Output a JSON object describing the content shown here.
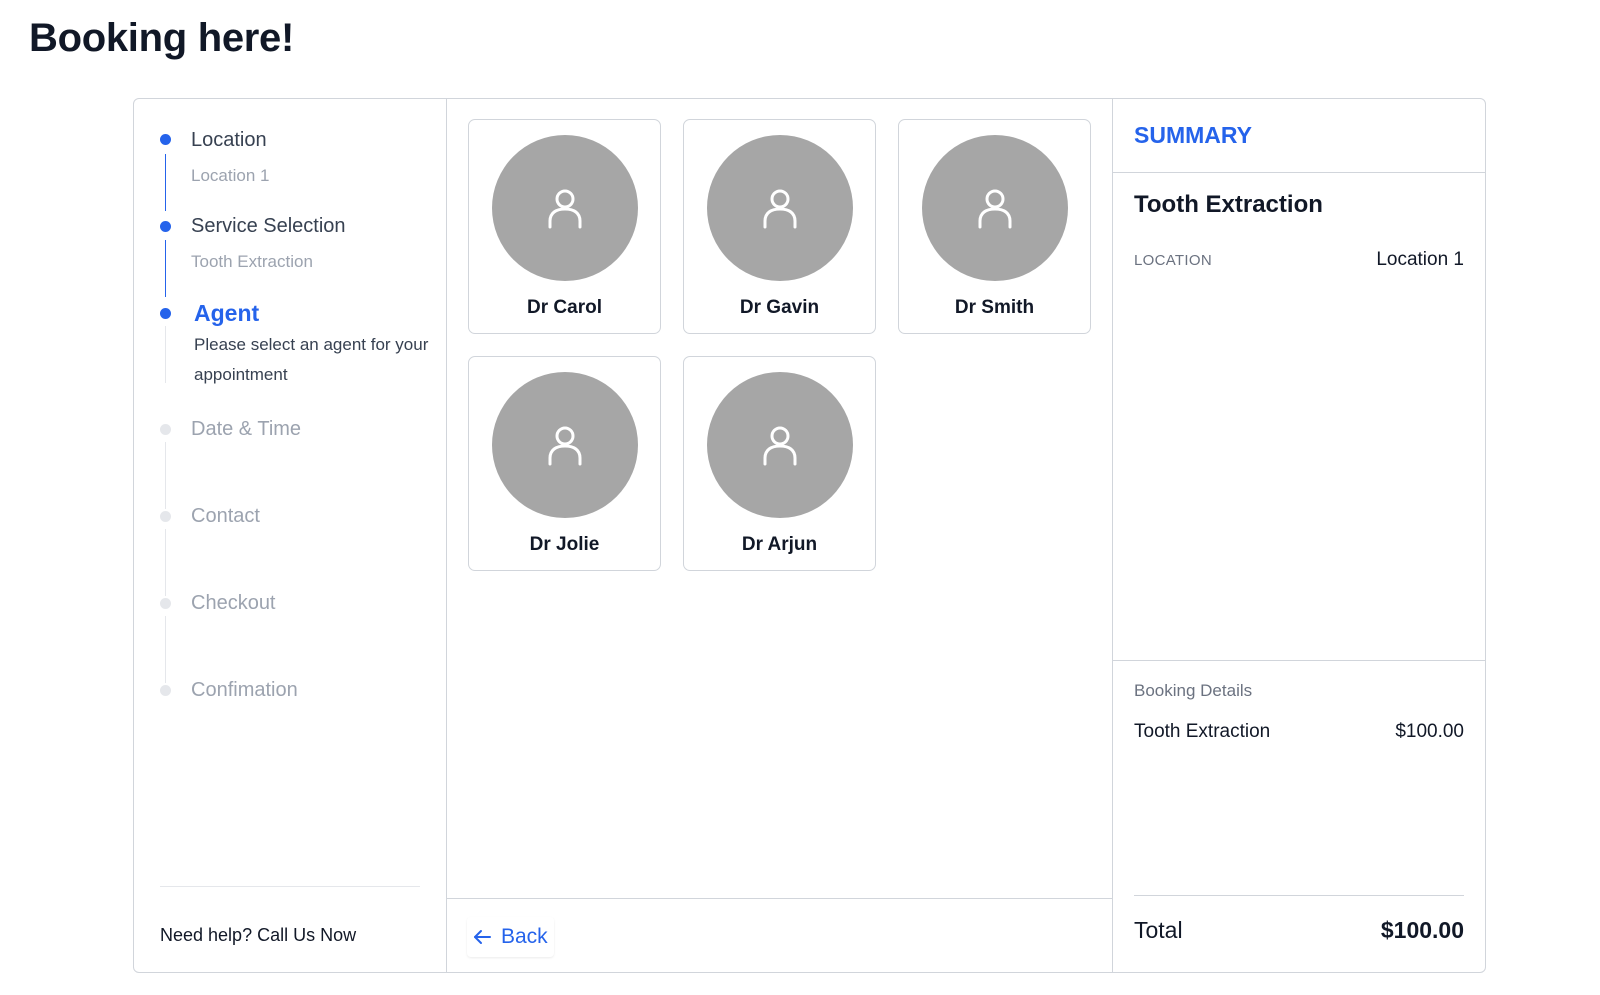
{
  "page": {
    "title": "Booking here!"
  },
  "steps": [
    {
      "label": "Location",
      "sub": "Location 1",
      "state": "done"
    },
    {
      "label": "Service Selection",
      "sub": "Tooth Extraction",
      "state": "done"
    },
    {
      "label": "Agent",
      "desc": "Please select an agent for your appointment",
      "state": "active"
    },
    {
      "label": "Date & Time",
      "state": "pending"
    },
    {
      "label": "Contact",
      "state": "pending"
    },
    {
      "label": "Checkout",
      "state": "pending"
    },
    {
      "label": "Confimation",
      "state": "pending"
    }
  ],
  "help": {
    "text": "Need help? Call Us Now"
  },
  "agents": [
    {
      "name": "Dr Carol",
      "icon": "user-icon"
    },
    {
      "name": "Dr Gavin",
      "icon": "user-icon"
    },
    {
      "name": "Dr Smith",
      "icon": "user-icon"
    },
    {
      "name": "Dr Jolie",
      "icon": "user-icon"
    },
    {
      "name": "Dr Arjun",
      "icon": "user-icon"
    }
  ],
  "footer": {
    "back_label": "Back",
    "back_icon": "arrow-left-icon"
  },
  "summary": {
    "title": "SUMMARY",
    "service": "Tooth Extraction",
    "location_label": "LOCATION",
    "location_value": "Location 1",
    "details_heading": "Booking Details",
    "items": [
      {
        "name": "Tooth Extraction",
        "price": "$100.00"
      }
    ],
    "total_label": "Total",
    "total_value": "$100.00"
  },
  "colors": {
    "accent": "#2563eb",
    "avatar_bg": "#a6a6a6",
    "border": "#d1d5db",
    "muted": "#9ca3af"
  }
}
